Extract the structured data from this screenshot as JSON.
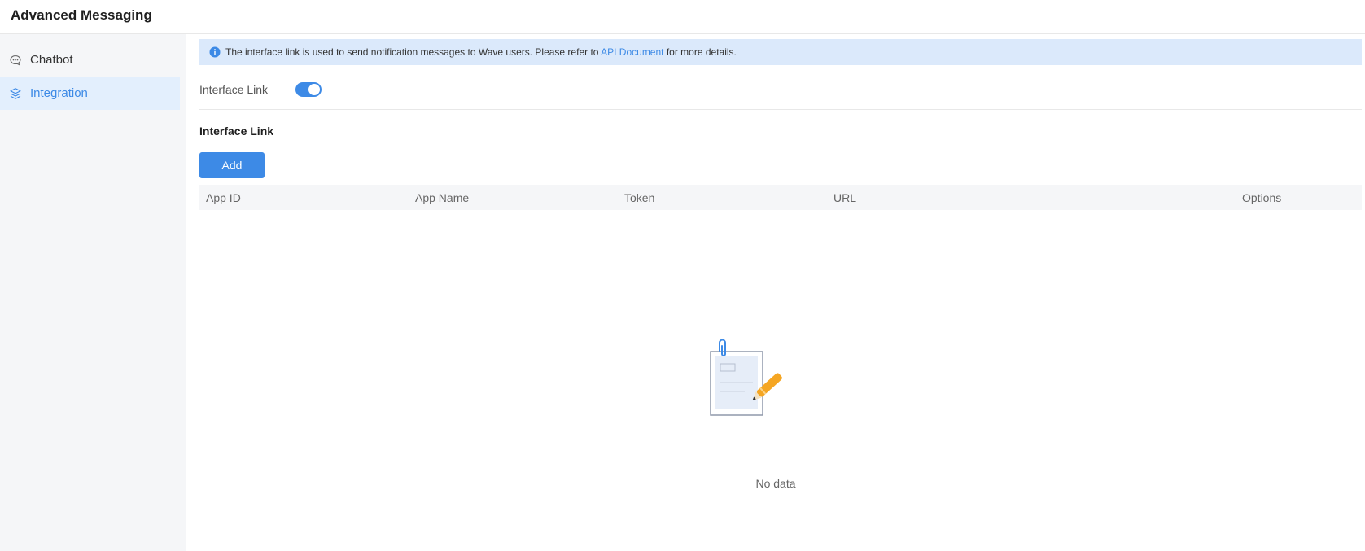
{
  "header": {
    "title": "Advanced Messaging"
  },
  "sidebar": {
    "items": [
      {
        "label": "Chatbot",
        "icon": "chat-bubble-icon",
        "active": false
      },
      {
        "label": "Integration",
        "icon": "layers-icon",
        "active": true
      }
    ]
  },
  "notice": {
    "text_before": "The interface link is used to send notification messages to Wave users. Please refer to ",
    "link_text": "API Document",
    "text_after": " for more details."
  },
  "settings": {
    "interface_link_label": "Interface Link",
    "interface_link_enabled": true
  },
  "section": {
    "title": "Interface Link"
  },
  "toolbar": {
    "add_label": "Add"
  },
  "table": {
    "columns": [
      "App ID",
      "App Name",
      "Token",
      "URL",
      "Options"
    ],
    "rows": [],
    "empty_text": "No data"
  },
  "colors": {
    "accent": "#3d8ae6",
    "notice_bg": "#dbe9fb",
    "sidebar_bg": "#f5f6f8",
    "active_item_bg": "#e3effd",
    "illustration_orange": "#f5a623"
  }
}
